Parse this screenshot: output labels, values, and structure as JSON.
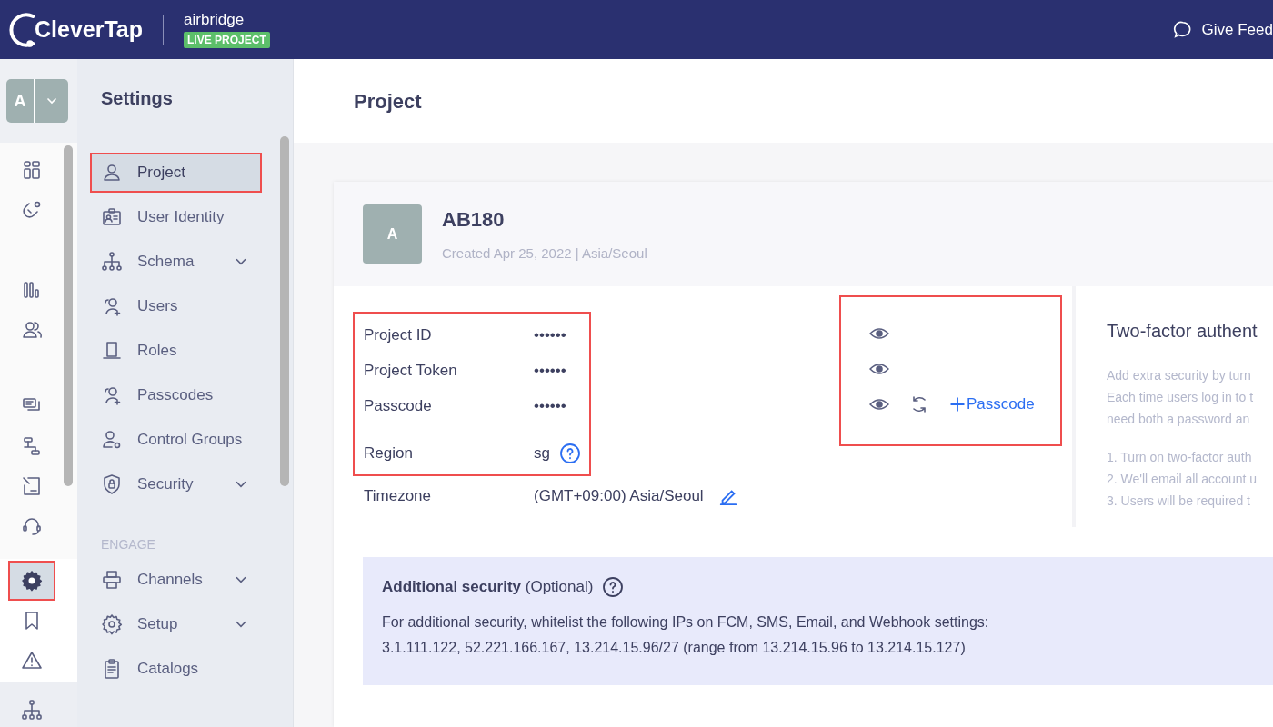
{
  "header": {
    "brand": "CleverTap",
    "project_name": "airbridge",
    "project_badge": "LIVE PROJECT",
    "feedback": "Give Feed"
  },
  "account_switcher": {
    "letter": "A"
  },
  "rail": [
    [
      {
        "selected": false,
        "highlighted": false
      },
      {
        "selected": false,
        "highlighted": false
      }
    ],
    [
      {
        "selected": false,
        "highlighted": false
      },
      {
        "selected": false,
        "highlighted": false
      }
    ],
    [
      {
        "selected": false,
        "highlighted": false
      },
      {
        "selected": false,
        "highlighted": false
      },
      {
        "selected": false,
        "highlighted": false
      },
      {
        "selected": false,
        "highlighted": false
      }
    ],
    [
      {
        "selected": true,
        "highlighted": true
      },
      {
        "selected": false,
        "highlighted": false
      },
      {
        "selected": false,
        "highlighted": false
      }
    ],
    [
      {
        "selected": false,
        "highlighted": false
      }
    ]
  ],
  "sidebar": {
    "title": "Settings",
    "items": [
      {
        "kind": "item",
        "label": "Project",
        "selected": true,
        "highlighted": true,
        "expandable": false
      },
      {
        "kind": "item",
        "label": "User Identity",
        "selected": false,
        "highlighted": false,
        "expandable": false
      },
      {
        "kind": "item",
        "label": "Schema",
        "selected": false,
        "highlighted": false,
        "expandable": true
      },
      {
        "kind": "item",
        "label": "Users",
        "selected": false,
        "highlighted": false,
        "expandable": false
      },
      {
        "kind": "item",
        "label": "Roles",
        "selected": false,
        "highlighted": false,
        "expandable": false
      },
      {
        "kind": "item",
        "label": "Passcodes",
        "selected": false,
        "highlighted": false,
        "expandable": false
      },
      {
        "kind": "item",
        "label": "Control Groups",
        "selected": false,
        "highlighted": false,
        "expandable": false
      },
      {
        "kind": "item",
        "label": "Security",
        "selected": false,
        "highlighted": false,
        "expandable": true
      },
      {
        "kind": "heading",
        "label": "ENGAGE"
      },
      {
        "kind": "item",
        "label": "Channels",
        "selected": false,
        "highlighted": false,
        "expandable": true
      },
      {
        "kind": "item",
        "label": "Setup",
        "selected": false,
        "highlighted": false,
        "expandable": true
      },
      {
        "kind": "item",
        "label": "Catalogs",
        "selected": false,
        "highlighted": false,
        "expandable": false
      }
    ]
  },
  "page_title": "Project",
  "project": {
    "avatar": "A",
    "name": "AB180",
    "subtitle": "Created Apr 25, 2022 | Asia/Seoul",
    "field_groups": [
      {
        "highlighted": true,
        "fields": [
          {
            "label": "Project ID",
            "value": "••••••"
          },
          {
            "label": "Project Token",
            "value": "••••••"
          },
          {
            "label": "Passcode",
            "value": "••••••"
          },
          {
            "label": "Region",
            "value": "sg",
            "help": true
          }
        ]
      },
      {
        "highlighted": false,
        "fields": [
          {
            "label": "Timezone",
            "value": "(GMT+09:00) Asia/Seoul",
            "editable": true
          }
        ]
      }
    ],
    "actions": {
      "highlighted": true,
      "rows": [
        {},
        {},
        {
          "regenerate": true,
          "add_label": "Passcode"
        }
      ]
    },
    "two_factor": {
      "title": "Two-factor authent",
      "description": [
        "Add extra security by turn",
        "Each time users log in to t",
        "need both a password an"
      ],
      "steps": [
        "1. Turn on two-factor auth",
        "2. We'll email all account u",
        "3. Users will be required t"
      ]
    }
  },
  "additional_security": {
    "title": "**Additional security** (Optional)",
    "lines": [
      "For additional security, whitelist the following IPs on FCM, SMS, Email, and Webhook settings:",
      "3.1.111.122, 52.221.166.167, 13.214.15.96/27 (range from 13.214.15.96 to 13.214.15.127)"
    ]
  }
}
